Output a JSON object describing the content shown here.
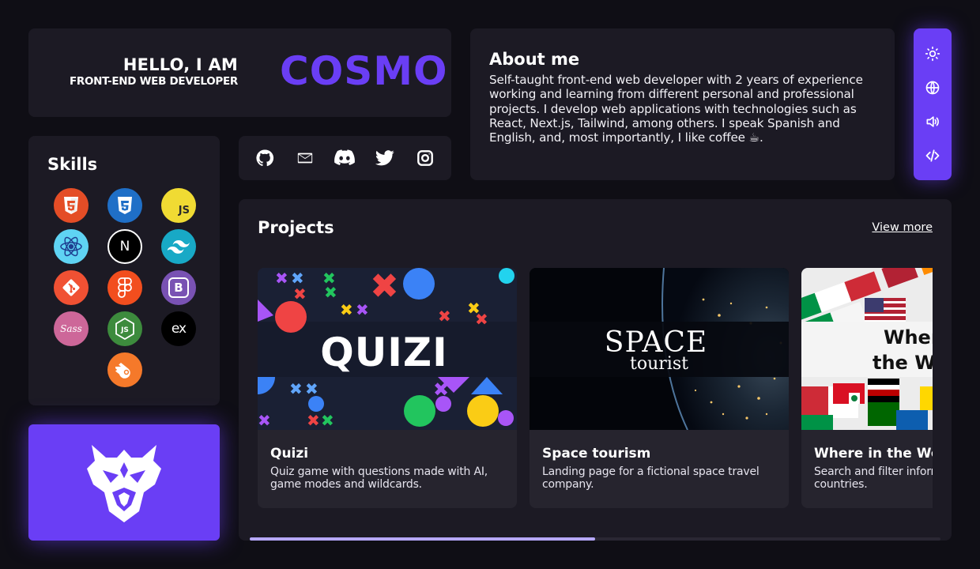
{
  "hero": {
    "greeting": "HELLO, I AM",
    "role": "FRONT-END WEB DEVELOPER",
    "name": "COSMO"
  },
  "about": {
    "title": "About me",
    "text": "Self-taught front-end web developer with 2 years of experience working and learning from different personal and professional projects. I develop web applications with technologies such as React, Next.js, Tailwind, among others. I speak Spanish and English, and, most importantly, I like coffee ☕."
  },
  "toolbar": {
    "items": [
      "sun-icon",
      "globe-icon",
      "volume-icon",
      "code-icon"
    ]
  },
  "socials": {
    "items": [
      "github-icon",
      "mail-icon",
      "discord-icon",
      "twitter-icon",
      "instagram-icon"
    ]
  },
  "skills": {
    "title": "Skills",
    "items": [
      {
        "name": "html5-icon",
        "label": "5",
        "color": "#e44d26"
      },
      {
        "name": "css3-icon",
        "label": "3",
        "color": "#1f6fc7"
      },
      {
        "name": "javascript-icon",
        "label": "JS",
        "color": "#f0db33"
      },
      {
        "name": "react-icon",
        "label": "⚛",
        "color": "#5fd3f3"
      },
      {
        "name": "nextjs-icon",
        "label": "N",
        "color": "#000000"
      },
      {
        "name": "tailwind-icon",
        "label": "~",
        "color": "#18a9c6"
      },
      {
        "name": "git-icon",
        "label": "◆",
        "color": "#f05133"
      },
      {
        "name": "figma-icon",
        "label": "F",
        "color": "#f24e1e"
      },
      {
        "name": "bootstrap-icon",
        "label": "B",
        "color": "#7952b3"
      },
      {
        "name": "sass-icon",
        "label": "Sass",
        "color": "#cd6799"
      },
      {
        "name": "nodejs-icon",
        "label": "JS",
        "color": "#3d8b3d"
      },
      {
        "name": "express-icon",
        "label": "ex",
        "color": "#000000"
      },
      {
        "name": "blender-icon",
        "label": "◉",
        "color": "#f5792a"
      }
    ]
  },
  "projects": {
    "title": "Projects",
    "view_more": "View more",
    "items": [
      {
        "title": "Quizi",
        "desc": "Quiz game with questions made with AI, game modes and wildcards.",
        "thumb_text": "QUIZI"
      },
      {
        "title": "Space tourism",
        "desc": "Landing page for a fictional space travel company.",
        "thumb_text": "SPACE",
        "thumb_sub": "tourist"
      },
      {
        "title": "Where in the World",
        "desc": "Search and filter information about countries.",
        "thumb_text": "Where in the World"
      }
    ],
    "scroll_progress": 0.5
  },
  "colors": {
    "accent": "#6a3ef5",
    "background": "#0f0e15",
    "card": "#1c1a24"
  }
}
